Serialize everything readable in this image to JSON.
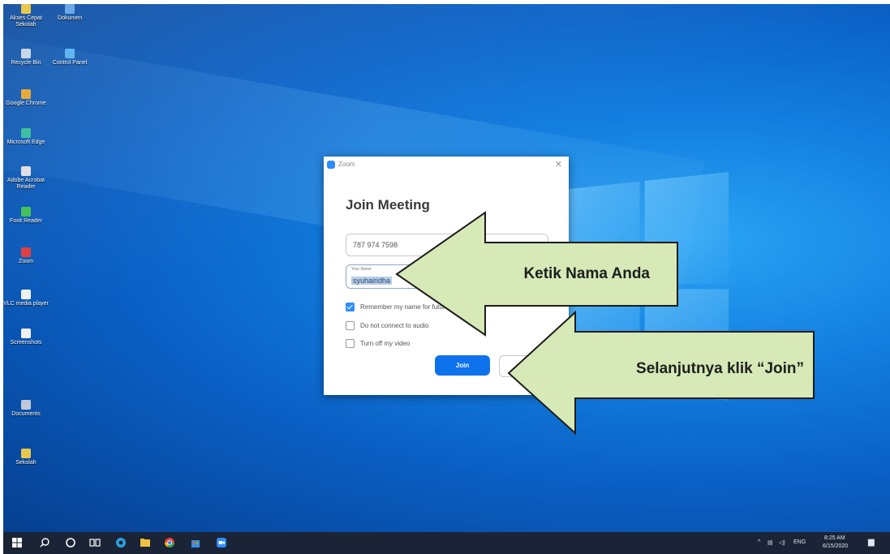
{
  "desktop": {
    "icons": [
      {
        "label": "Akses Cepat Sekolah",
        "name": "desktop-icon-akses-cepat",
        "color": "#e8c84a"
      },
      {
        "label": "Dokumen",
        "name": "desktop-icon-dokumen",
        "color": "#6aa8e8"
      },
      {
        "label": "Recycle Bin",
        "name": "desktop-icon-recycle-bin",
        "color": "#c9d6e6"
      },
      {
        "label": "Control Panel",
        "name": "desktop-icon-control-panel",
        "color": "#5fb6f0"
      },
      {
        "label": "Google Chrome",
        "name": "desktop-icon-google-chrome",
        "color": "#e8a93a"
      },
      {
        "label": "Microsoft Edge",
        "name": "desktop-icon-microsoft-edge",
        "color": "#3ec0a0"
      },
      {
        "label": "Adobe Acrobat Reader",
        "name": "desktop-icon-adobe-reader",
        "color": "#e0e0e0"
      },
      {
        "label": "Foxit Reader",
        "name": "desktop-icon-foxit-reader",
        "color": "#46c25a"
      },
      {
        "label": "Zoom",
        "name": "desktop-icon-zoom",
        "color": "#e04040"
      },
      {
        "label": "VLC media player",
        "name": "desktop-icon-vlc",
        "color": "#f0f0f0"
      },
      {
        "label": "Screenshots",
        "name": "desktop-icon-screenshots",
        "color": "#f0f0f0"
      },
      {
        "label": "Documents",
        "name": "desktop-icon-documents",
        "color": "#c0c8d8"
      },
      {
        "label": "Sekolah",
        "name": "desktop-icon-sekolah",
        "color": "#e8c84a"
      }
    ]
  },
  "zoom_dialog": {
    "title": "Zoom",
    "heading": "Join Meeting",
    "meeting_id": "787 974 7598",
    "name_label": "Your Name",
    "name_value": "syuhairidha",
    "options": [
      {
        "label": "Remember my name for future meetings",
        "checked": true
      },
      {
        "label": "Do not connect to audio",
        "checked": false
      },
      {
        "label": "Turn off my video",
        "checked": false
      }
    ],
    "join_label": "Join",
    "close_glyph": "✕"
  },
  "callouts": {
    "name_hint": "Ketik Nama Anda",
    "join_hint": "Selanjutnya klik “Join”",
    "fill_color": "#d6e9b6"
  },
  "taskbar": {
    "time": "8:25 AM",
    "date": "6/15/2020",
    "language": "ENG",
    "apps": [
      "start-icon",
      "search-icon",
      "cortana-icon",
      "task-view-icon",
      "edge-icon",
      "file-explorer-icon",
      "chrome-icon",
      "store-icon",
      "zoom-icon"
    ]
  }
}
